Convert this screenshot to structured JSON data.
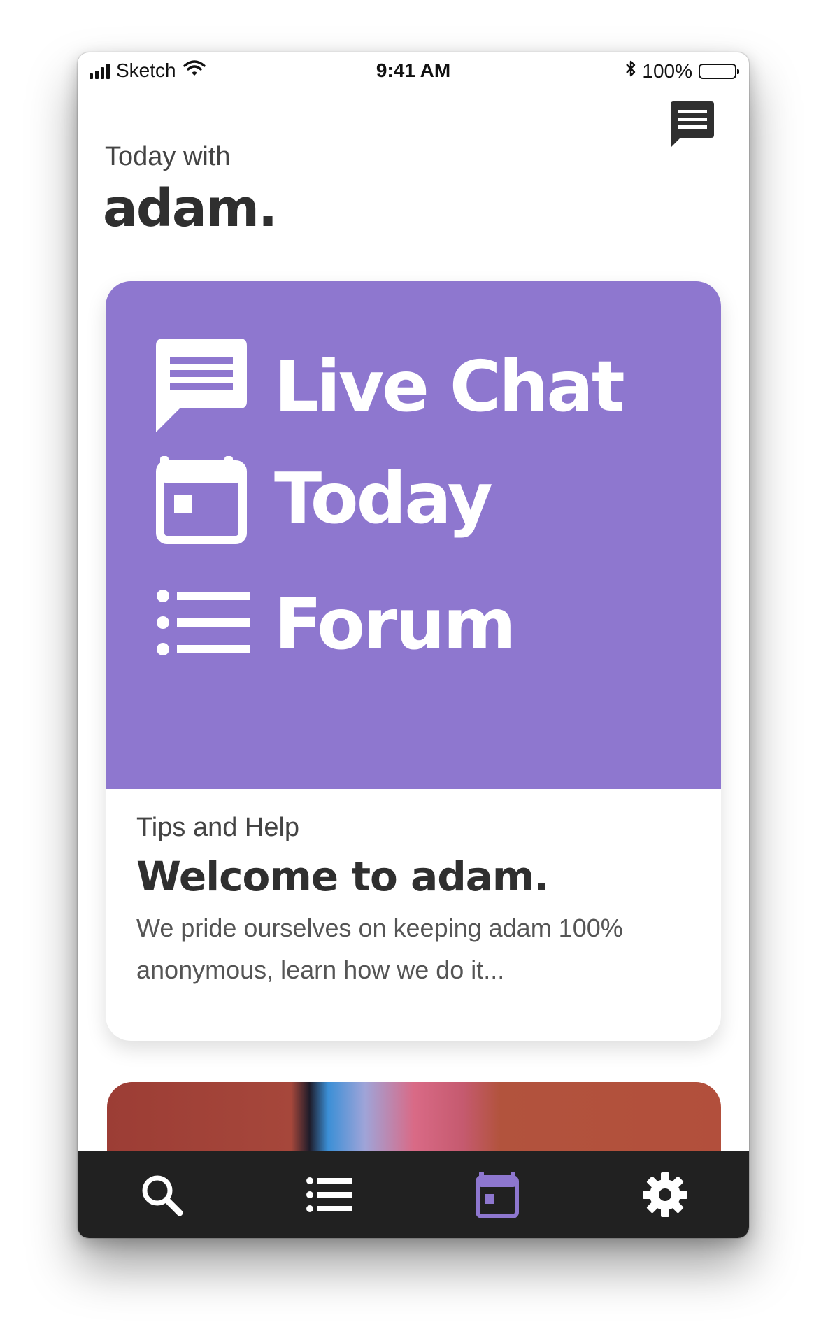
{
  "status_bar": {
    "carrier": "Sketch",
    "time": "9:41 AM",
    "battery": "100%"
  },
  "header": {
    "subtitle": "Today with",
    "brand": "adam."
  },
  "menu": {
    "items": [
      {
        "label": "Live Chat",
        "icon": "chat-icon"
      },
      {
        "label": "Today",
        "icon": "calendar-icon"
      },
      {
        "label": "Forum",
        "icon": "list-icon"
      }
    ]
  },
  "card": {
    "category": "Tips and Help",
    "title": "Welcome to adam.",
    "text": "We pride ourselves on keeping adam 100% anonymous, learn how we do it..."
  },
  "tab_bar": {
    "tabs": [
      {
        "icon": "search-icon",
        "active": false
      },
      {
        "icon": "list-icon",
        "active": false
      },
      {
        "icon": "calendar-icon",
        "active": true
      },
      {
        "icon": "gear-icon",
        "active": false
      }
    ]
  },
  "colors": {
    "accent": "#8e77cf",
    "tab_bar": "#212121",
    "tab_icon": "#ffffff",
    "tab_active": "#8e77cf",
    "heading_text": "#2f2f2f"
  }
}
